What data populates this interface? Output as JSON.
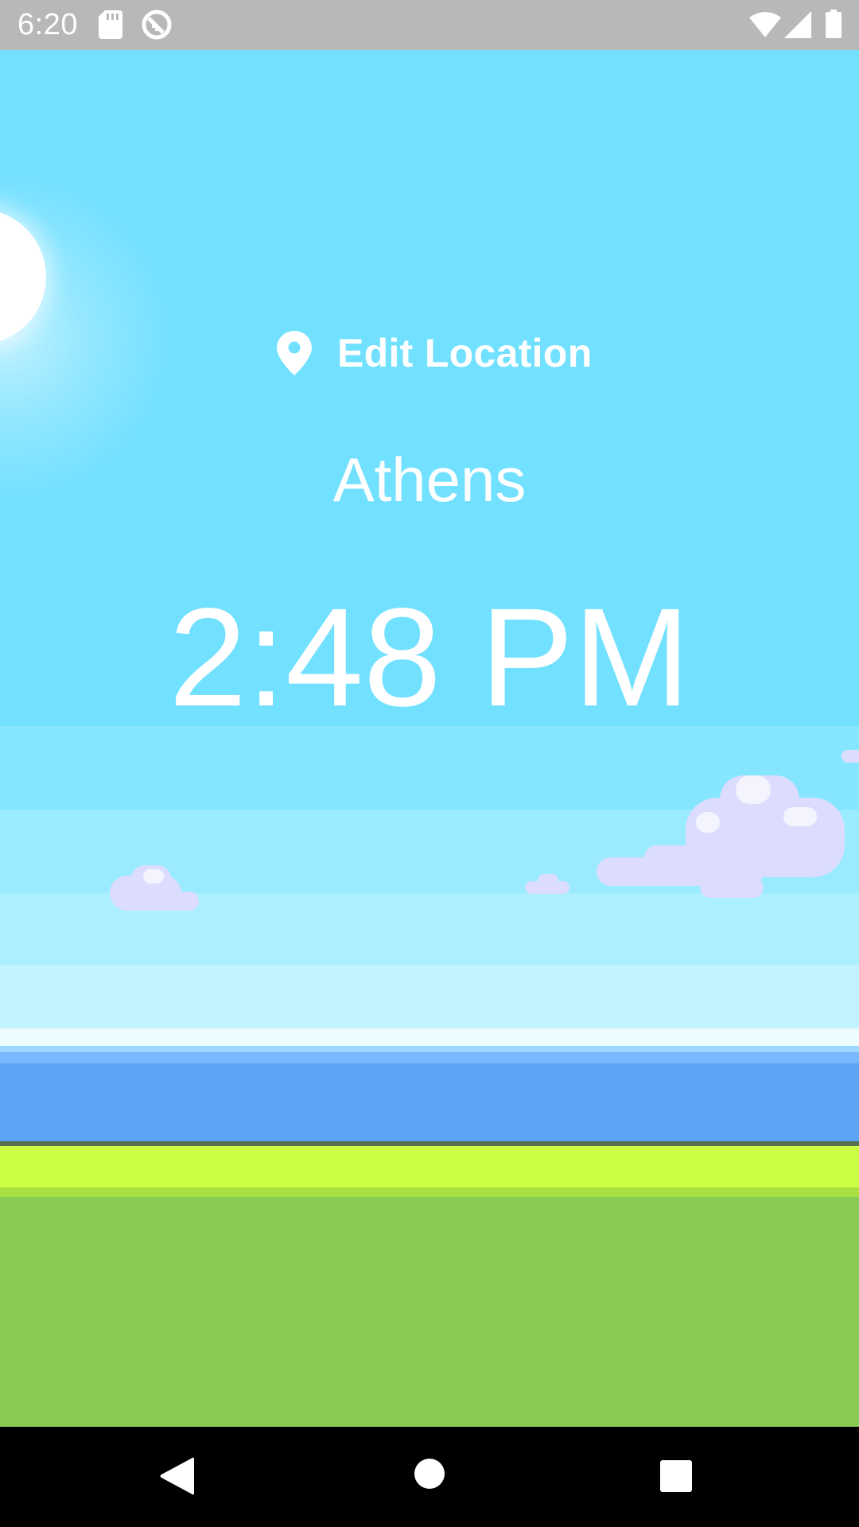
{
  "status_bar": {
    "time": "6:20",
    "icons": [
      "sd-card-icon",
      "sync-icon",
      "wifi-icon",
      "cell-signal-icon",
      "battery-icon"
    ]
  },
  "location": {
    "edit_label": "Edit Location",
    "icon": "location-pin-icon",
    "city": "Athens"
  },
  "clock": {
    "time": "2:48 PM"
  },
  "nav_bar": {
    "icons": [
      "back-icon",
      "home-icon",
      "recents-icon"
    ]
  },
  "colors": {
    "sky": "#72e0ff",
    "sky_pale": "#c2f4ff",
    "sea": "#5ba4f8",
    "grass_light": "#ccff44",
    "grass": "#88cc55",
    "cloud": "#dcdcff",
    "text": "#ffffff",
    "status_bar": "#b8b8b8",
    "nav_bar": "#000000"
  }
}
